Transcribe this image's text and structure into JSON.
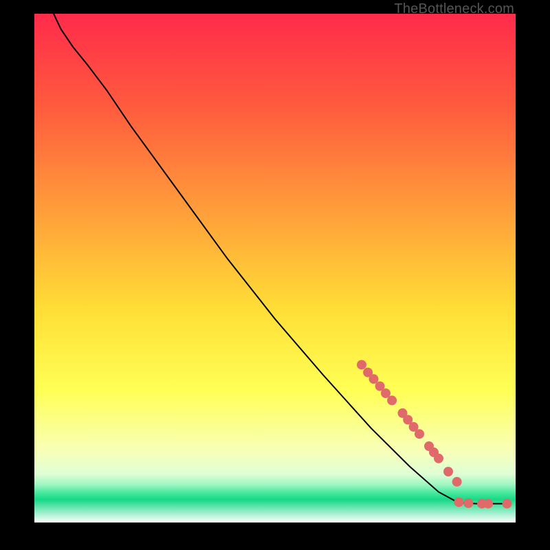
{
  "watermark": "TheBottleneck.com",
  "chart_data": {
    "type": "line",
    "title": "",
    "xlabel": "",
    "ylabel": "",
    "xlim": [
      0,
      100
    ],
    "ylim": [
      0,
      100
    ],
    "background_gradient": {
      "stops": [
        {
          "pos": 0.0,
          "color": "#ff2b4b"
        },
        {
          "pos": 0.18,
          "color": "#ff5a3e"
        },
        {
          "pos": 0.4,
          "color": "#ffa23a"
        },
        {
          "pos": 0.58,
          "color": "#ffde36"
        },
        {
          "pos": 0.74,
          "color": "#ffff55"
        },
        {
          "pos": 0.86,
          "color": "#f8ffb8"
        },
        {
          "pos": 0.905,
          "color": "#dfffd6"
        },
        {
          "pos": 0.925,
          "color": "#9ff7c2"
        },
        {
          "pos": 0.945,
          "color": "#37e597"
        },
        {
          "pos": 0.955,
          "color": "#18d886"
        },
        {
          "pos": 1.0,
          "color": "#ffffff"
        }
      ]
    },
    "series": [
      {
        "name": "curve",
        "color": "#000000",
        "points": [
          {
            "x": 4.0,
            "y": 100.0
          },
          {
            "x": 5.5,
            "y": 97.0
          },
          {
            "x": 8.0,
            "y": 93.5
          },
          {
            "x": 11.0,
            "y": 90.0
          },
          {
            "x": 15.0,
            "y": 85.0
          },
          {
            "x": 20.0,
            "y": 78.0
          },
          {
            "x": 30.0,
            "y": 65.0
          },
          {
            "x": 40.0,
            "y": 52.0
          },
          {
            "x": 50.0,
            "y": 40.0
          },
          {
            "x": 60.0,
            "y": 29.0
          },
          {
            "x": 70.0,
            "y": 18.5
          },
          {
            "x": 78.0,
            "y": 11.0
          },
          {
            "x": 84.0,
            "y": 6.0
          },
          {
            "x": 87.5,
            "y": 4.2
          },
          {
            "x": 89.5,
            "y": 3.8
          },
          {
            "x": 92.0,
            "y": 3.7
          },
          {
            "x": 95.0,
            "y": 3.7
          },
          {
            "x": 98.5,
            "y": 3.7
          }
        ]
      }
    ],
    "markers": {
      "name": "dots",
      "color": "#e06a6a",
      "radius_px": 7,
      "points": [
        {
          "x": 68.0,
          "y": 31.0
        },
        {
          "x": 69.3,
          "y": 29.5
        },
        {
          "x": 70.5,
          "y": 28.2
        },
        {
          "x": 71.8,
          "y": 26.8
        },
        {
          "x": 73.0,
          "y": 25.4
        },
        {
          "x": 74.3,
          "y": 24.0
        },
        {
          "x": 76.5,
          "y": 21.5
        },
        {
          "x": 77.6,
          "y": 20.2
        },
        {
          "x": 78.8,
          "y": 18.8
        },
        {
          "x": 80.0,
          "y": 17.4
        },
        {
          "x": 82.0,
          "y": 15.0
        },
        {
          "x": 83.0,
          "y": 13.8
        },
        {
          "x": 84.0,
          "y": 12.6
        },
        {
          "x": 86.0,
          "y": 10.0
        },
        {
          "x": 87.8,
          "y": 8.0
        },
        {
          "x": 88.2,
          "y": 4.0
        },
        {
          "x": 90.2,
          "y": 3.8
        },
        {
          "x": 93.0,
          "y": 3.7
        },
        {
          "x": 94.3,
          "y": 3.7
        },
        {
          "x": 98.2,
          "y": 3.7
        }
      ]
    }
  }
}
